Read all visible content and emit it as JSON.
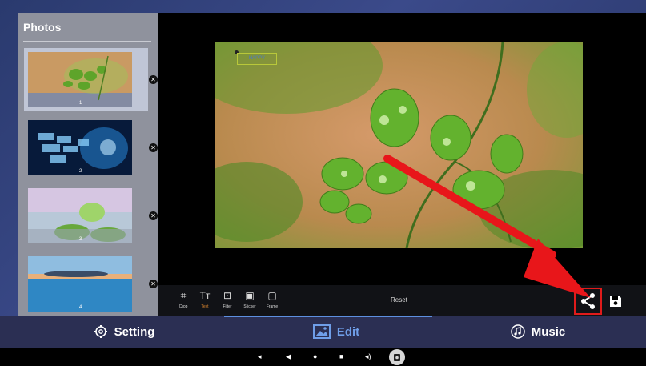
{
  "photos_panel": {
    "title": "Photos",
    "items": [
      {
        "index": "1",
        "selected": true
      },
      {
        "index": "2",
        "selected": false
      },
      {
        "index": "3",
        "selected": false
      },
      {
        "index": "4",
        "selected": false
      }
    ],
    "delete_glyph": "✕"
  },
  "editor": {
    "text_sticker": "HAPPY"
  },
  "toolbar": {
    "tools": [
      {
        "label": "Crop",
        "icon": "crop-icon",
        "glyph": "⌗"
      },
      {
        "label": "Text",
        "icon": "text-icon",
        "glyph": "Tт"
      },
      {
        "label": "Filter",
        "icon": "filter-icon",
        "glyph": "⊡"
      },
      {
        "label": "Sticker",
        "icon": "sticker-icon",
        "glyph": "▣"
      },
      {
        "label": "Frame",
        "icon": "frame-icon",
        "glyph": "▢"
      }
    ],
    "active_tool": "Text",
    "reset_label": "Reset"
  },
  "tabs": {
    "setting": "Setting",
    "edit": "Edit",
    "music": "Music",
    "active": "Edit"
  },
  "colors": {
    "accent": "#5d8fe0",
    "highlight_red": "#e01b1b",
    "active_tool": "#e0892f"
  }
}
